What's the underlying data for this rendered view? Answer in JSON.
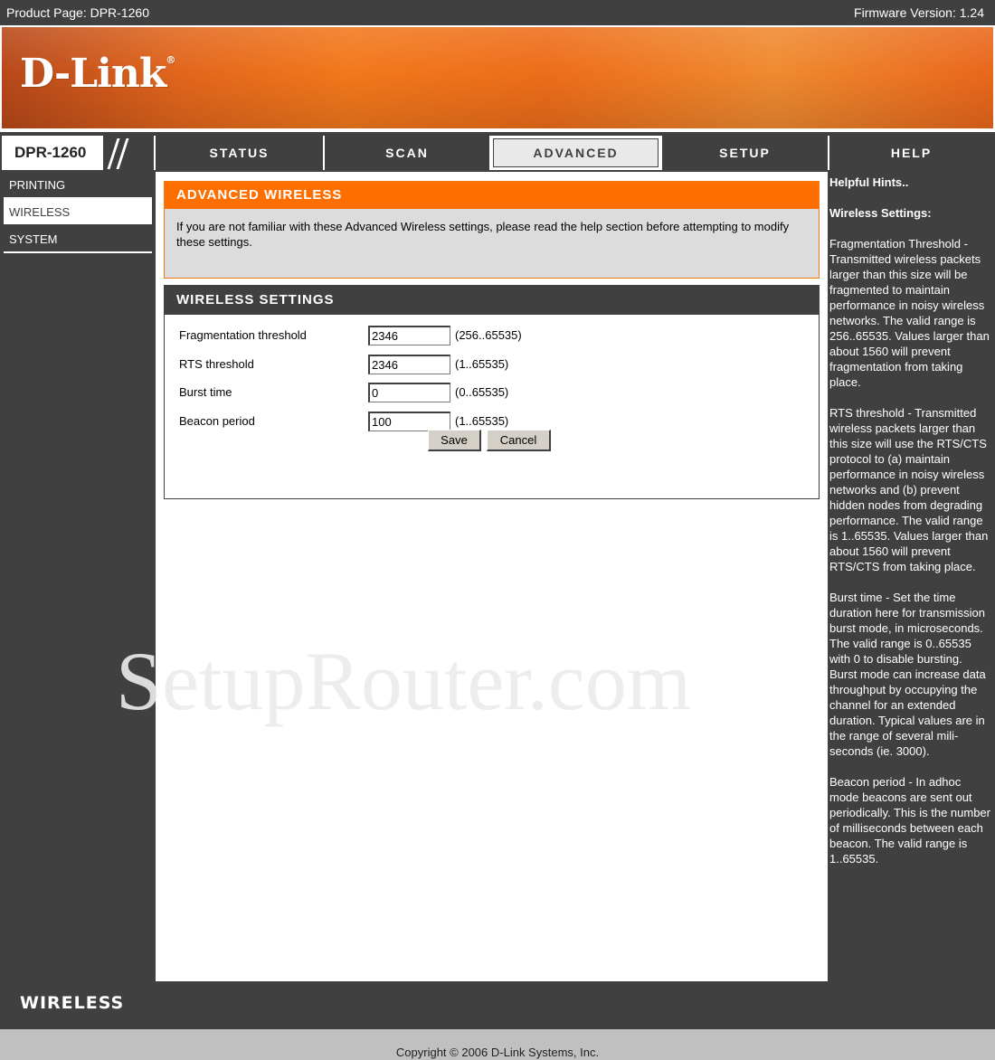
{
  "topbar": {
    "product": "Product Page: DPR-1260",
    "firmware": "Firmware Version: 1.24"
  },
  "brand": {
    "logo": "D-Link",
    "trademark": "®",
    "wireless_label": "WIRELESS"
  },
  "model": "DPR-1260",
  "nav": {
    "status": "STATUS",
    "scan": "SCAN",
    "advanced": "ADVANCED",
    "setup": "SETUP",
    "help": "HELP"
  },
  "sidebar": {
    "items": [
      {
        "label": "PRINTING"
      },
      {
        "label": "WIRELESS"
      },
      {
        "label": "SYSTEM"
      }
    ]
  },
  "advanced_wireless": {
    "title": "ADVANCED WIRELESS",
    "description": "If you are not familiar with these Advanced Wireless settings, please read the help section before attempting to modify these settings."
  },
  "wireless_settings": {
    "title": "WIRELESS SETTINGS",
    "fields": [
      {
        "label": "Fragmentation threshold",
        "value": "2346",
        "range": "(256..65535)"
      },
      {
        "label": "RTS threshold",
        "value": "2346",
        "range": "(1..65535)"
      },
      {
        "label": "Burst time",
        "value": "0",
        "range": "(0..65535)"
      },
      {
        "label": "Beacon period",
        "value": "100",
        "range": "(1..65535)"
      }
    ],
    "save_label": "Save",
    "cancel_label": "Cancel"
  },
  "hints": {
    "title": "Helpful Hints..",
    "subtitle": "Wireless Settings:",
    "paragraphs": [
      "Fragmentation Threshold - Transmitted wireless packets larger than this size will be fragmented to maintain performance in noisy wireless networks. The valid range is 256..65535. Values larger than about 1560 will prevent fragmentation from taking place.",
      "RTS threshold - Transmitted wireless packets larger than this size will use the RTS/CTS protocol to (a) maintain performance in noisy wireless networks and (b) prevent hidden nodes from degrading performance. The valid range is 1..65535. Values larger than about 1560 will prevent RTS/CTS from taking place.",
      "Burst time - Set the time duration here for transmission burst mode, in microseconds. The valid range is 0..65535 with 0 to disable bursting. Burst mode can increase data throughput by occupying the channel for an extended duration. Typical values are in the range of several mili-seconds (ie. 3000).",
      "Beacon period - In adhoc mode beacons are sent out periodically. This is the number of milliseconds between each beacon. The valid range is 1..65535."
    ]
  },
  "watermark": "SetupRouter.com",
  "footer": {
    "copyright": "Copyright © 2006 D-Link Systems, Inc."
  },
  "colors": {
    "dark_gray": "#404040",
    "orange": "#ff6f00",
    "light_gray": "#dcdcdc"
  }
}
